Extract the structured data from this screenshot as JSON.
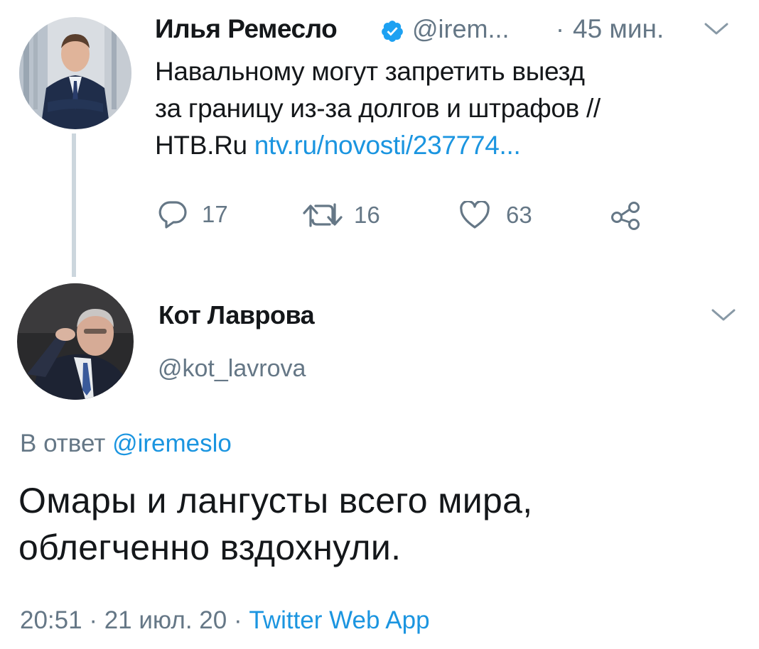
{
  "tweet1": {
    "author_name": "Илья Ремесло",
    "author_handle": "@irem...",
    "separator": "·",
    "time": "45 мин.",
    "text_line1": "Навальному могут запретить выезд",
    "text_line2": "за границу из-за долгов и штрафов //",
    "text_line3_prefix": "НТВ.Ru",
    "link": "ntv.ru/novosti/237774...",
    "replies": "17",
    "retweets": "16",
    "likes": "63",
    "icons": [
      "verified-icon",
      "chevron-down-icon",
      "reply-icon",
      "retweet-icon",
      "like-icon",
      "share-icon"
    ]
  },
  "tweet2": {
    "author_name": "Кот Лаврова",
    "author_handle": "@kot_lavrova",
    "reply_prefix": "В ответ",
    "reply_to": "@iremeslo",
    "text_line1": "Омары и лангусты всего мира,",
    "text_line2": "облегченно вздохнули.",
    "time": "20:51",
    "date": "21 июл. 20",
    "source": "Twitter Web App",
    "dot": "·"
  },
  "colors": {
    "text": "#14171a",
    "secondary": "#657786",
    "link": "#1b95e0",
    "verified": "#1da1f2",
    "thread_line": "#ccd6dd"
  }
}
